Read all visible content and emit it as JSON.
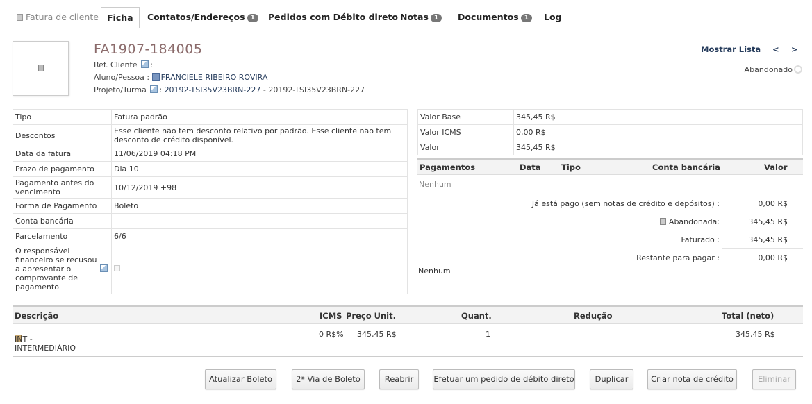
{
  "tabs": [
    {
      "label": "Fatura de cliente"
    },
    {
      "label": "Ficha"
    },
    {
      "label": "Contatos/Endereços",
      "badge": "1"
    },
    {
      "label": "Pedidos com Débito direto"
    },
    {
      "label": "Notas",
      "badge": "1"
    },
    {
      "label": "Documentos",
      "badge": "1"
    },
    {
      "label": "Log"
    }
  ],
  "header": {
    "ref": "FA1907-184005",
    "ref_cliente_label": "Ref. Cliente",
    "ref_cliente_sep": ":",
    "aluno_label": "Aluno/Pessoa :",
    "aluno_value": "FRANCIELE RIBEIRO ROVIRA",
    "projeto_label": "Projeto/Turma",
    "projeto_sep": ":",
    "projeto_link": "20192-TSI35V23BRN-227",
    "projeto_desc": "- 20192-TSI35V23BRN-227",
    "mostrar_lista": "Mostrar Lista",
    "prev": "<",
    "next": ">",
    "status": "Abandonado"
  },
  "details": [
    {
      "k": "Tipo",
      "v": "Fatura padrão"
    },
    {
      "k": "Descontos",
      "v": "Esse cliente não tem desconto relativo por padrão. Esse cliente não tem desconto de crédito disponível."
    },
    {
      "k": "Data da fatura",
      "v": "11/06/2019 04:18 PM"
    },
    {
      "k": "Prazo de pagamento",
      "v": "Dia 10"
    },
    {
      "k": "Pagamento antes do vencimento",
      "v": "10/12/2019 +98"
    },
    {
      "k": "Forma de Pagamento",
      "v": "Boleto"
    },
    {
      "k": "Conta bancária",
      "v": ""
    },
    {
      "k": "Parcelamento",
      "v": "6/6"
    },
    {
      "k": "O responsável financeiro se recusou a apresentar o comprovante de pagamento",
      "v": ""
    }
  ],
  "amounts": [
    {
      "k": "Valor Base",
      "v": "345,45 R$"
    },
    {
      "k": "Valor ICMS",
      "v": "0,00 R$"
    },
    {
      "k": "Valor",
      "v": "345,45 R$"
    }
  ],
  "payments": {
    "headers": [
      "Pagamentos",
      "Data",
      "Tipo",
      "Conta bancária",
      "Valor"
    ],
    "none": "Nenhum",
    "summary": [
      {
        "label": "Já está pago (sem notas de crédito e depósitos) :",
        "value": "0,00 R$"
      },
      {
        "label": "Abandonada:",
        "value": "345,45 R$"
      },
      {
        "label": "Faturado :",
        "value": "345,45 R$"
      },
      {
        "label": "Restante para pagar :",
        "value": "0,00 R$"
      }
    ],
    "none2": "Nenhum"
  },
  "lines": {
    "headers": [
      "Descrição",
      "ICMS",
      "Preço Unit.",
      "Quant.",
      "Redução",
      "Total (neto)"
    ],
    "rows": [
      {
        "desc": "INT - INTERMEDIÁRIO",
        "icms": "0 R$%",
        "price": "345,45 R$",
        "qty": "1",
        "reduction": "",
        "total": "345,45 R$"
      }
    ]
  },
  "buttons": [
    {
      "label": "Atualizar Boleto"
    },
    {
      "label": "2ª Via de Boleto"
    },
    {
      "label": "Reabrir"
    },
    {
      "label": "Efetuar um pedido de débito direto"
    },
    {
      "label": "Duplicar"
    },
    {
      "label": "Criar nota de crédito"
    },
    {
      "label": "Eliminar",
      "disabled": true
    }
  ]
}
